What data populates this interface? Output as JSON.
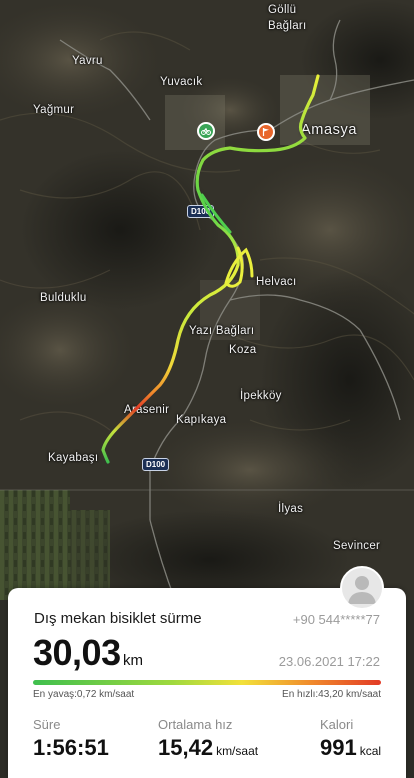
{
  "map": {
    "places": {
      "gollu": "Göllü",
      "baglari": "Bağları",
      "yavru": "Yavru",
      "yavucik": "Yuvacık",
      "yagmur": "Yağmur",
      "amasya": "Amasya",
      "helvaci": "Helvacı",
      "bulduklu": "Bulduklu",
      "yazi_baglari": "Yazı Bağları",
      "koza": "Koza",
      "ipekkoy": "İpekköy",
      "arasenir": "Arasenir",
      "kapikaya": "Kapıkaya",
      "kayabasi": "Kayabaşı",
      "ilyas": "İlyas",
      "sevincer": "Sevincer"
    },
    "road_shields": [
      "D100",
      "D100"
    ],
    "start_icon": "bicycle-icon",
    "end_icon": "flag-icon"
  },
  "summary": {
    "activity_title": "Dış mekan bisiklet sürme",
    "phone": "+90 544*****77",
    "distance": "30,03",
    "distance_unit": "km",
    "datetime": "23.06.2021 17:22",
    "slowest": "En yavaş:0,72 km/saat",
    "fastest": "En hızlı:43,20 km/saat",
    "stats": [
      {
        "label": "Süre",
        "value": "1:56:51",
        "unit": ""
      },
      {
        "label": "Ortalama hız",
        "value": "15,42",
        "unit": "km/saat"
      },
      {
        "label": "Kalori",
        "value": "991",
        "unit": "kcal"
      }
    ]
  },
  "colors": {
    "route_slow": "#3fbf4e",
    "route_mid": "#f2e13a",
    "route_fast": "#e23b26",
    "start_pin": "#3aa557",
    "end_pin": "#e8662c"
  }
}
